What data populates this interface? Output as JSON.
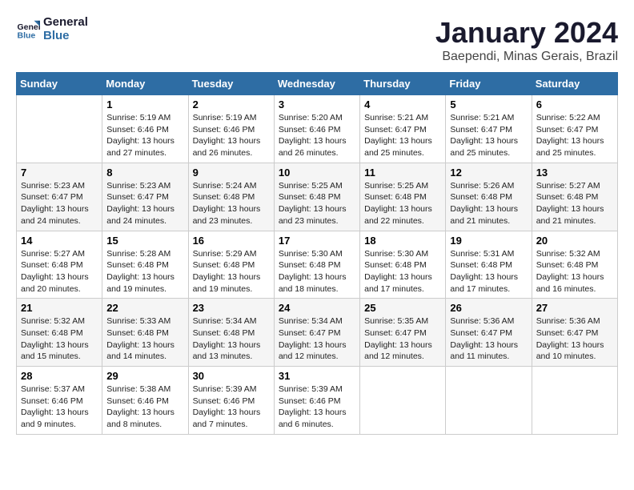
{
  "logo": {
    "line1": "General",
    "line2": "Blue"
  },
  "title": "January 2024",
  "subtitle": "Baependi, Minas Gerais, Brazil",
  "days_of_week": [
    "Sunday",
    "Monday",
    "Tuesday",
    "Wednesday",
    "Thursday",
    "Friday",
    "Saturday"
  ],
  "weeks": [
    [
      {
        "day": "",
        "sunrise": "",
        "sunset": "",
        "daylight": ""
      },
      {
        "day": "1",
        "sunrise": "Sunrise: 5:19 AM",
        "sunset": "Sunset: 6:46 PM",
        "daylight": "Daylight: 13 hours and 27 minutes."
      },
      {
        "day": "2",
        "sunrise": "Sunrise: 5:19 AM",
        "sunset": "Sunset: 6:46 PM",
        "daylight": "Daylight: 13 hours and 26 minutes."
      },
      {
        "day": "3",
        "sunrise": "Sunrise: 5:20 AM",
        "sunset": "Sunset: 6:46 PM",
        "daylight": "Daylight: 13 hours and 26 minutes."
      },
      {
        "day": "4",
        "sunrise": "Sunrise: 5:21 AM",
        "sunset": "Sunset: 6:47 PM",
        "daylight": "Daylight: 13 hours and 25 minutes."
      },
      {
        "day": "5",
        "sunrise": "Sunrise: 5:21 AM",
        "sunset": "Sunset: 6:47 PM",
        "daylight": "Daylight: 13 hours and 25 minutes."
      },
      {
        "day": "6",
        "sunrise": "Sunrise: 5:22 AM",
        "sunset": "Sunset: 6:47 PM",
        "daylight": "Daylight: 13 hours and 25 minutes."
      }
    ],
    [
      {
        "day": "7",
        "sunrise": "Sunrise: 5:23 AM",
        "sunset": "Sunset: 6:47 PM",
        "daylight": "Daylight: 13 hours and 24 minutes."
      },
      {
        "day": "8",
        "sunrise": "Sunrise: 5:23 AM",
        "sunset": "Sunset: 6:47 PM",
        "daylight": "Daylight: 13 hours and 24 minutes."
      },
      {
        "day": "9",
        "sunrise": "Sunrise: 5:24 AM",
        "sunset": "Sunset: 6:48 PM",
        "daylight": "Daylight: 13 hours and 23 minutes."
      },
      {
        "day": "10",
        "sunrise": "Sunrise: 5:25 AM",
        "sunset": "Sunset: 6:48 PM",
        "daylight": "Daylight: 13 hours and 23 minutes."
      },
      {
        "day": "11",
        "sunrise": "Sunrise: 5:25 AM",
        "sunset": "Sunset: 6:48 PM",
        "daylight": "Daylight: 13 hours and 22 minutes."
      },
      {
        "day": "12",
        "sunrise": "Sunrise: 5:26 AM",
        "sunset": "Sunset: 6:48 PM",
        "daylight": "Daylight: 13 hours and 21 minutes."
      },
      {
        "day": "13",
        "sunrise": "Sunrise: 5:27 AM",
        "sunset": "Sunset: 6:48 PM",
        "daylight": "Daylight: 13 hours and 21 minutes."
      }
    ],
    [
      {
        "day": "14",
        "sunrise": "Sunrise: 5:27 AM",
        "sunset": "Sunset: 6:48 PM",
        "daylight": "Daylight: 13 hours and 20 minutes."
      },
      {
        "day": "15",
        "sunrise": "Sunrise: 5:28 AM",
        "sunset": "Sunset: 6:48 PM",
        "daylight": "Daylight: 13 hours and 19 minutes."
      },
      {
        "day": "16",
        "sunrise": "Sunrise: 5:29 AM",
        "sunset": "Sunset: 6:48 PM",
        "daylight": "Daylight: 13 hours and 19 minutes."
      },
      {
        "day": "17",
        "sunrise": "Sunrise: 5:30 AM",
        "sunset": "Sunset: 6:48 PM",
        "daylight": "Daylight: 13 hours and 18 minutes."
      },
      {
        "day": "18",
        "sunrise": "Sunrise: 5:30 AM",
        "sunset": "Sunset: 6:48 PM",
        "daylight": "Daylight: 13 hours and 17 minutes."
      },
      {
        "day": "19",
        "sunrise": "Sunrise: 5:31 AM",
        "sunset": "Sunset: 6:48 PM",
        "daylight": "Daylight: 13 hours and 17 minutes."
      },
      {
        "day": "20",
        "sunrise": "Sunrise: 5:32 AM",
        "sunset": "Sunset: 6:48 PM",
        "daylight": "Daylight: 13 hours and 16 minutes."
      }
    ],
    [
      {
        "day": "21",
        "sunrise": "Sunrise: 5:32 AM",
        "sunset": "Sunset: 6:48 PM",
        "daylight": "Daylight: 13 hours and 15 minutes."
      },
      {
        "day": "22",
        "sunrise": "Sunrise: 5:33 AM",
        "sunset": "Sunset: 6:48 PM",
        "daylight": "Daylight: 13 hours and 14 minutes."
      },
      {
        "day": "23",
        "sunrise": "Sunrise: 5:34 AM",
        "sunset": "Sunset: 6:48 PM",
        "daylight": "Daylight: 13 hours and 13 minutes."
      },
      {
        "day": "24",
        "sunrise": "Sunrise: 5:34 AM",
        "sunset": "Sunset: 6:47 PM",
        "daylight": "Daylight: 13 hours and 12 minutes."
      },
      {
        "day": "25",
        "sunrise": "Sunrise: 5:35 AM",
        "sunset": "Sunset: 6:47 PM",
        "daylight": "Daylight: 13 hours and 12 minutes."
      },
      {
        "day": "26",
        "sunrise": "Sunrise: 5:36 AM",
        "sunset": "Sunset: 6:47 PM",
        "daylight": "Daylight: 13 hours and 11 minutes."
      },
      {
        "day": "27",
        "sunrise": "Sunrise: 5:36 AM",
        "sunset": "Sunset: 6:47 PM",
        "daylight": "Daylight: 13 hours and 10 minutes."
      }
    ],
    [
      {
        "day": "28",
        "sunrise": "Sunrise: 5:37 AM",
        "sunset": "Sunset: 6:46 PM",
        "daylight": "Daylight: 13 hours and 9 minutes."
      },
      {
        "day": "29",
        "sunrise": "Sunrise: 5:38 AM",
        "sunset": "Sunset: 6:46 PM",
        "daylight": "Daylight: 13 hours and 8 minutes."
      },
      {
        "day": "30",
        "sunrise": "Sunrise: 5:39 AM",
        "sunset": "Sunset: 6:46 PM",
        "daylight": "Daylight: 13 hours and 7 minutes."
      },
      {
        "day": "31",
        "sunrise": "Sunrise: 5:39 AM",
        "sunset": "Sunset: 6:46 PM",
        "daylight": "Daylight: 13 hours and 6 minutes."
      },
      {
        "day": "",
        "sunrise": "",
        "sunset": "",
        "daylight": ""
      },
      {
        "day": "",
        "sunrise": "",
        "sunset": "",
        "daylight": ""
      },
      {
        "day": "",
        "sunrise": "",
        "sunset": "",
        "daylight": ""
      }
    ]
  ]
}
